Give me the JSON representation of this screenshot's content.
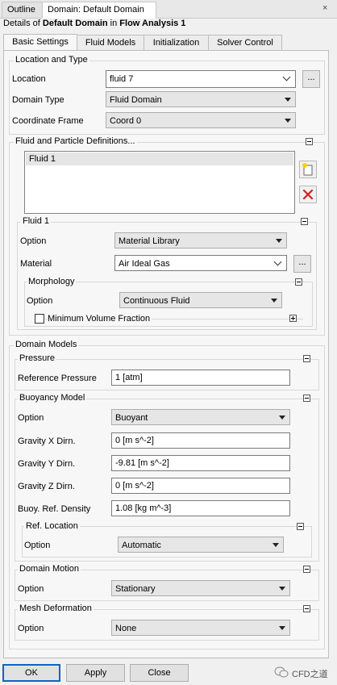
{
  "tabs": {
    "outline": "Outline",
    "domain": "Domain: Default Domain",
    "close": "×"
  },
  "details": {
    "prefix": "Details of ",
    "object": "Default Domain",
    "middle": " in ",
    "analysis": "Flow Analysis 1"
  },
  "subtabs": [
    "Basic Settings",
    "Fluid Models",
    "Initialization",
    "Solver Control"
  ],
  "location_type": {
    "title": "Location and Type",
    "location_label": "Location",
    "location_value": "fluid 7",
    "domain_type_label": "Domain Type",
    "domain_type_value": "Fluid Domain",
    "coord_label": "Coordinate Frame",
    "coord_value": "Coord 0"
  },
  "fluid_defs": {
    "title": "Fluid and Particle Definitions...",
    "list": [
      "Fluid 1"
    ],
    "fluid1": {
      "title": "Fluid 1",
      "option_label": "Option",
      "option_value": "Material Library",
      "material_label": "Material",
      "material_value": "Air Ideal Gas",
      "morphology": {
        "title": "Morphology",
        "option_label": "Option",
        "option_value": "Continuous Fluid",
        "min_vol_label": "Minimum Volume Fraction"
      }
    }
  },
  "domain_models": {
    "title": "Domain Models",
    "pressure": {
      "title": "Pressure",
      "ref_label": "Reference Pressure",
      "ref_value": "1 [atm]"
    },
    "buoyancy": {
      "title": "Buoyancy Model",
      "option_label": "Option",
      "option_value": "Buoyant",
      "gx_label": "Gravity X Dirn.",
      "gx_value": "0 [m s^-2]",
      "gy_label": "Gravity Y Dirn.",
      "gy_value": "-9.81 [m s^-2]",
      "gz_label": "Gravity Z Dirn.",
      "gz_value": "0 [m s^-2]",
      "density_label": "Buoy. Ref. Density",
      "density_value": "1.08 [kg m^-3]",
      "ref_location": {
        "title": "Ref. Location",
        "option_label": "Option",
        "option_value": "Automatic"
      }
    },
    "motion": {
      "title": "Domain Motion",
      "option_label": "Option",
      "option_value": "Stationary"
    },
    "mesh": {
      "title": "Mesh Deformation",
      "option_label": "Option",
      "option_value": "None"
    }
  },
  "buttons": {
    "ok": "OK",
    "apply": "Apply",
    "close": "Close"
  },
  "watermark": "CFD之道",
  "icons": {
    "new": "new-item-icon",
    "delete": "delete-icon",
    "wechat": "wechat-icon"
  },
  "colors": {
    "delete": "#d62020",
    "default_button": "#0a64c8"
  }
}
